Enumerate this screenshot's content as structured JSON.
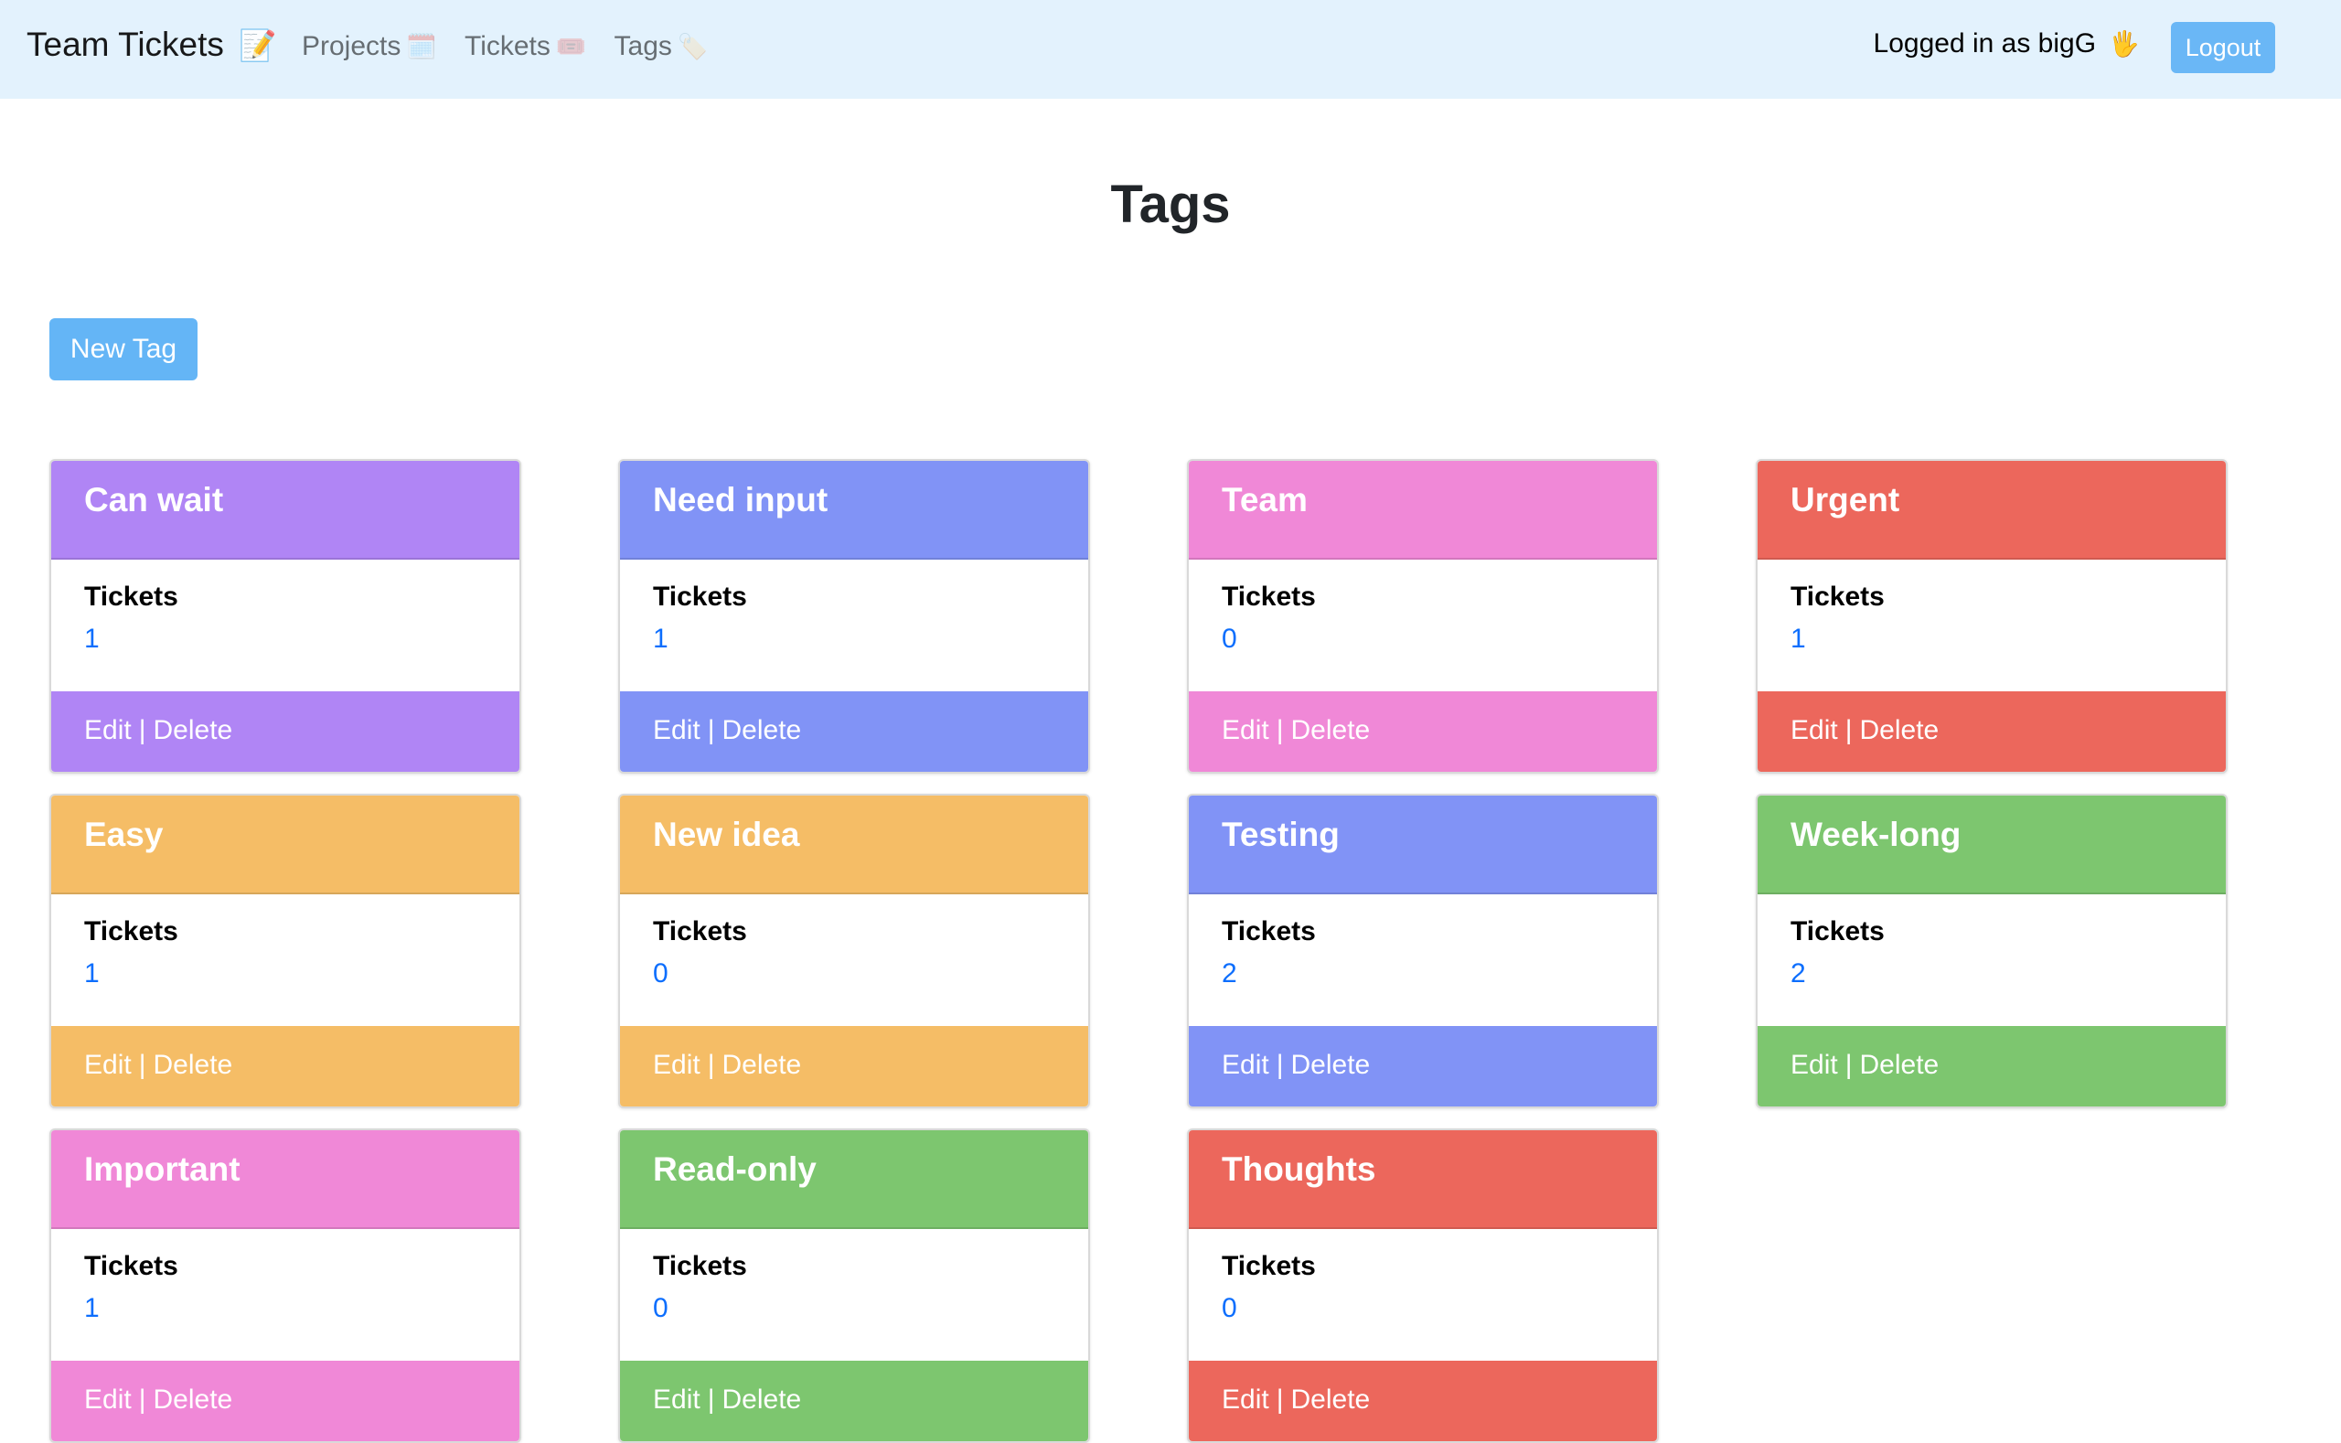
{
  "navbar": {
    "brand": "Team Tickets",
    "brand_icon": "📝",
    "links": [
      {
        "label": "Projects",
        "icon": "🗓️"
      },
      {
        "label": "Tickets",
        "icon": "🎟️"
      },
      {
        "label": "Tags",
        "icon": "🏷️"
      }
    ],
    "user_text": "Logged in as bigG",
    "user_icon": "🖐️",
    "logout_label": "Logout"
  },
  "page": {
    "title": "Tags",
    "new_tag_label": "New Tag"
  },
  "card_labels": {
    "tickets": "Tickets",
    "edit": "Edit",
    "separator": "|",
    "delete": "Delete"
  },
  "tags": [
    {
      "name": "Can wait",
      "tickets": "1",
      "color": "#b085f5"
    },
    {
      "name": "Need input",
      "tickets": "1",
      "color": "#8193f6"
    },
    {
      "name": "Team",
      "tickets": "0",
      "color": "#f088d7"
    },
    {
      "name": "Urgent",
      "tickets": "1",
      "color": "#ec675c"
    },
    {
      "name": "Easy",
      "tickets": "1",
      "color": "#f5bd66"
    },
    {
      "name": "New idea",
      "tickets": "0",
      "color": "#f5bd66"
    },
    {
      "name": "Testing",
      "tickets": "2",
      "color": "#8193f6"
    },
    {
      "name": "Week-long",
      "tickets": "2",
      "color": "#7dc66f"
    },
    {
      "name": "Important",
      "tickets": "1",
      "color": "#f088d7"
    },
    {
      "name": "Read-only",
      "tickets": "0",
      "color": "#7dc66f"
    },
    {
      "name": "Thoughts",
      "tickets": "0",
      "color": "#ec675c"
    }
  ]
}
